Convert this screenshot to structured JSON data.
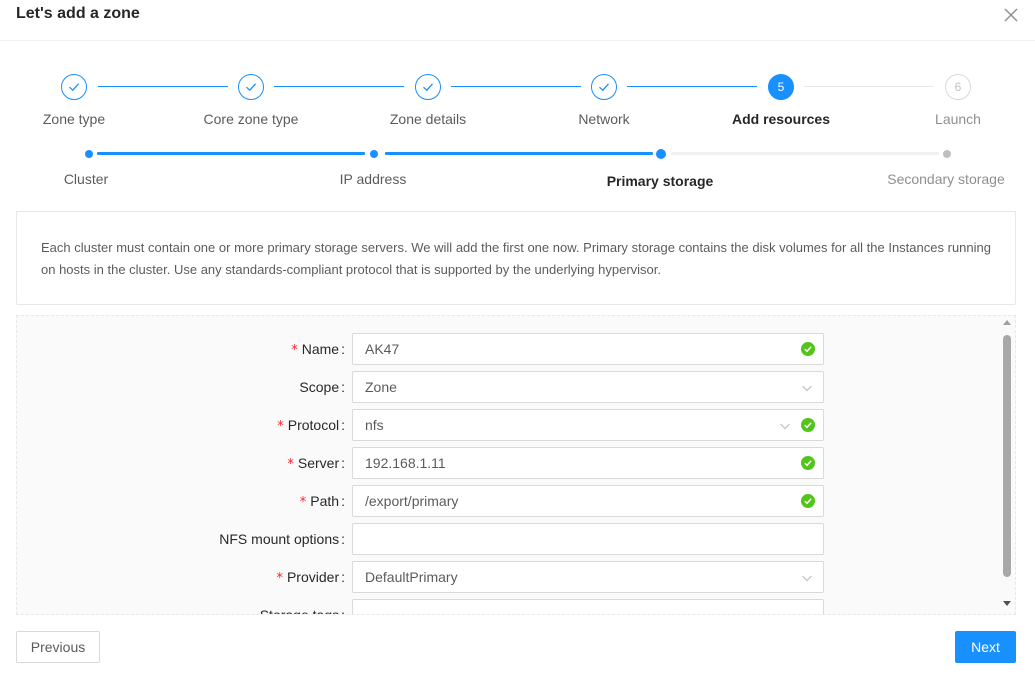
{
  "modal": {
    "title": "Let's add a zone"
  },
  "steps": [
    {
      "label": "Zone type",
      "status": "finish"
    },
    {
      "label": "Core zone type",
      "status": "finish"
    },
    {
      "label": "Zone details",
      "status": "finish"
    },
    {
      "label": "Network",
      "status": "finish"
    },
    {
      "label": "Add resources",
      "status": "process",
      "number": "5"
    },
    {
      "label": "Launch",
      "status": "wait",
      "number": "6"
    }
  ],
  "substeps": [
    {
      "label": "Cluster",
      "status": "finish"
    },
    {
      "label": "IP address",
      "status": "finish"
    },
    {
      "label": "Primary storage",
      "status": "process"
    },
    {
      "label": "Secondary storage",
      "status": "wait"
    }
  ],
  "description": "Each cluster must contain one or more primary storage servers. We will add the first one now. Primary storage contains the disk volumes for all the Instances running on hosts in the cluster. Use any standards-compliant protocol that is supported by the underlying hypervisor.",
  "form": {
    "fields": [
      {
        "label": "Name",
        "required": true,
        "value": "AK47",
        "type": "input",
        "valid": true
      },
      {
        "label": "Scope",
        "required": false,
        "value": "Zone",
        "type": "select",
        "valid": false
      },
      {
        "label": "Protocol",
        "required": true,
        "value": "nfs",
        "type": "select",
        "valid": true
      },
      {
        "label": "Server",
        "required": true,
        "value": "192.168.1.11",
        "type": "input",
        "valid": true
      },
      {
        "label": "Path",
        "required": true,
        "value": "/export/primary",
        "type": "input",
        "valid": true
      },
      {
        "label": "NFS mount options",
        "required": false,
        "value": "",
        "type": "input",
        "valid": false
      },
      {
        "label": "Provider",
        "required": true,
        "value": "DefaultPrimary",
        "type": "select",
        "valid": false
      },
      {
        "label": "Storage tags",
        "required": false,
        "value": "",
        "type": "input",
        "valid": false
      }
    ]
  },
  "footer": {
    "previous_label": "Previous",
    "next_label": "Next"
  },
  "colors": {
    "primary": "#1890ff",
    "success": "#52c41a",
    "required": "#f5222d"
  }
}
